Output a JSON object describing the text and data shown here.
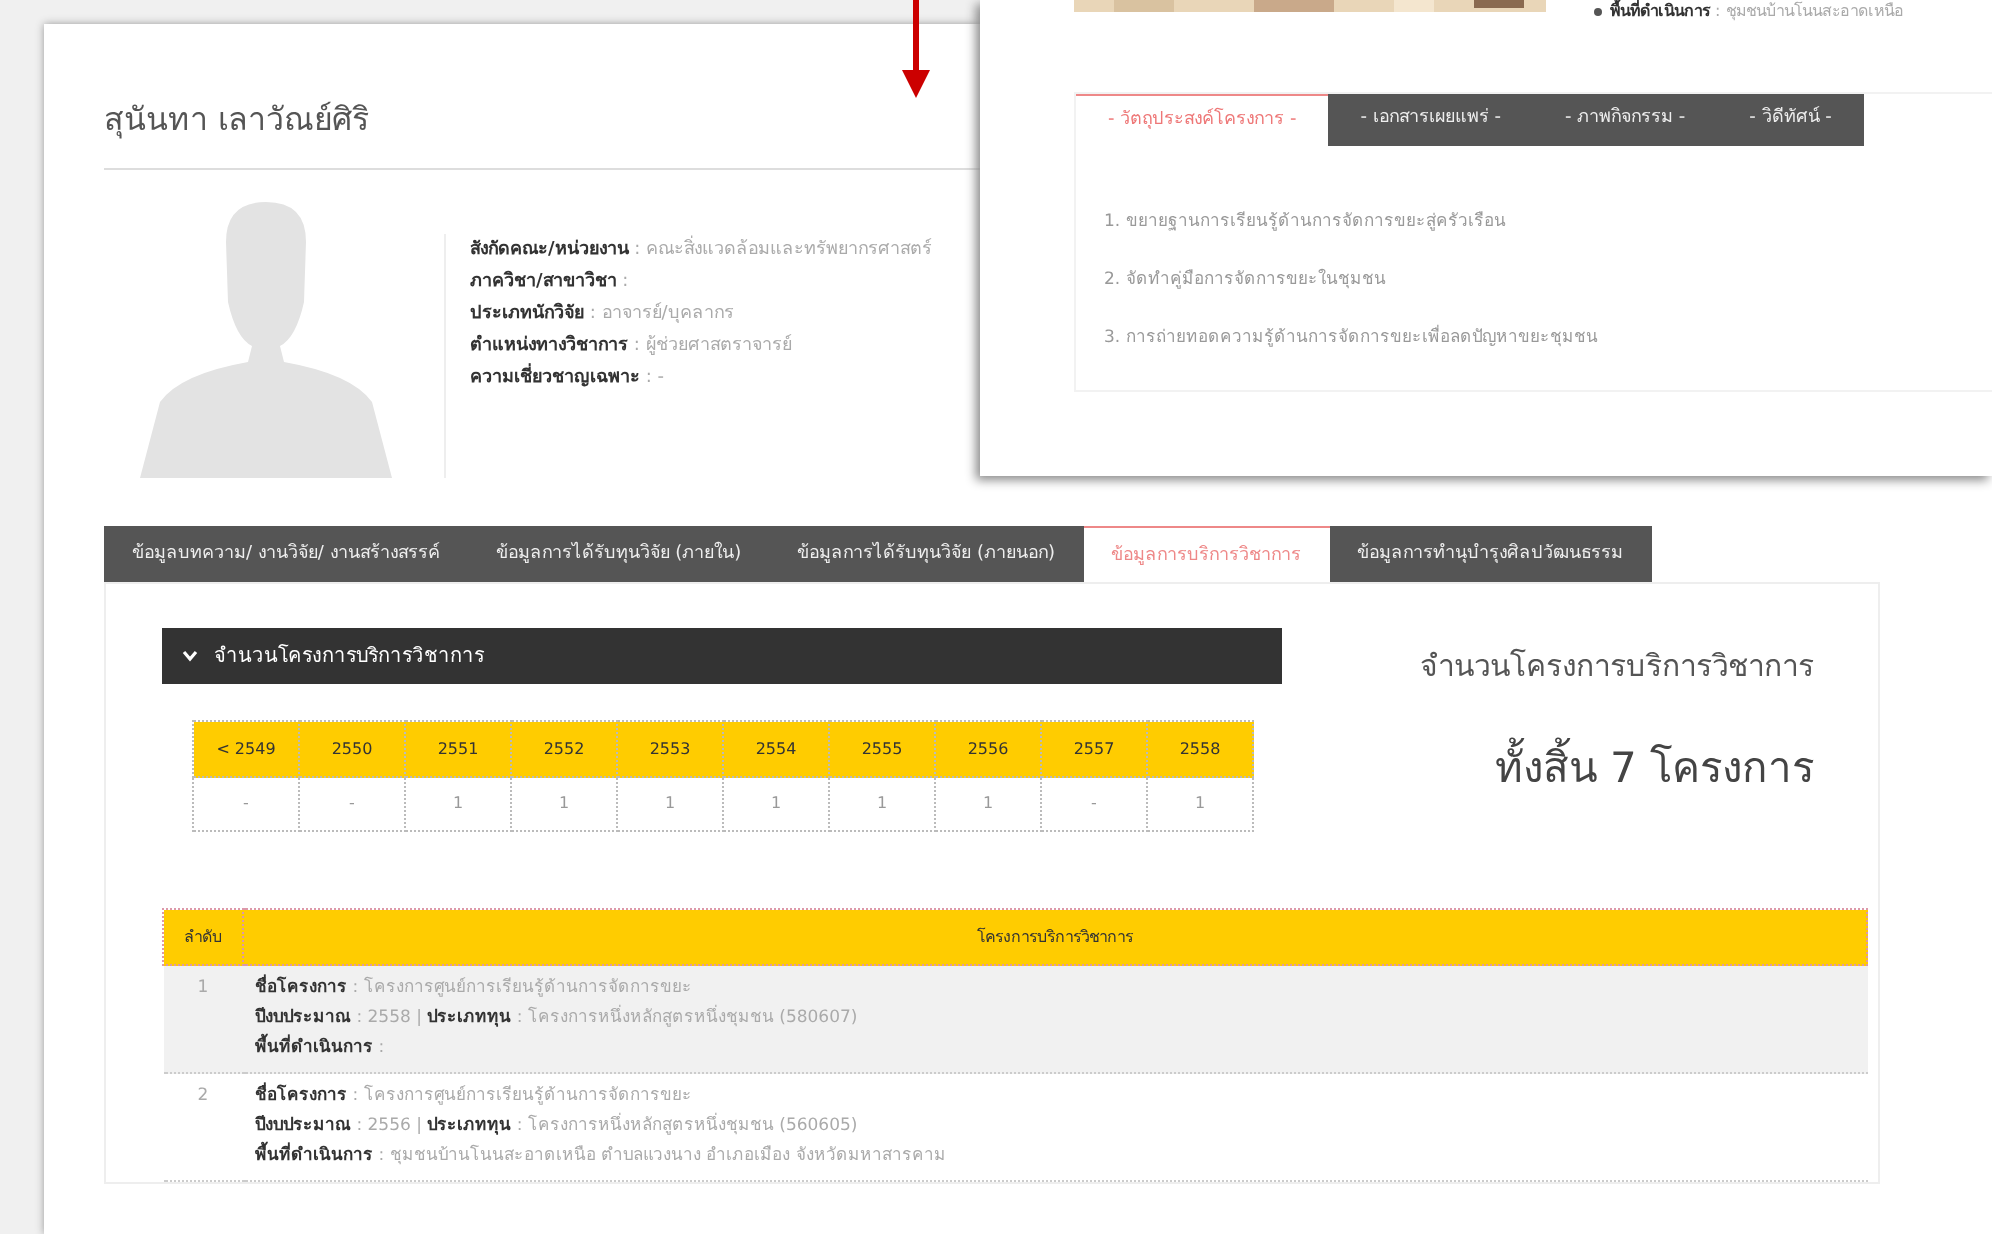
{
  "profile": {
    "name": "สุนันทา เลาวัณย์ศิริ",
    "fields": [
      {
        "label": "สังกัดคณะ/หน่วยงาน",
        "value": ": คณะสิ่งแวดล้อมและทรัพยากรศาสตร์"
      },
      {
        "label": "ภาควิชา/สาขาวิชา",
        "value": ":"
      },
      {
        "label": "ประเภทนักวิจัย",
        "value": ": อาจารย์/บุคลากร"
      },
      {
        "label": "ตำแหน่งทางวิชาการ",
        "value": ": ผู้ช่วยศาสตราจารย์"
      },
      {
        "label": "ความเชี่ยวชาญเฉพาะ",
        "value": ": -"
      }
    ]
  },
  "tabs": [
    {
      "label": "ข้อมูลบทความ/ งานวิจัย/ งานสร้างสรรค์",
      "selected": false
    },
    {
      "label": "ข้อมูลการได้รับทุนวิจัย (ภายใน)",
      "selected": false
    },
    {
      "label": "ข้อมูลการได้รับทุนวิจัย (ภายนอก)",
      "selected": false
    },
    {
      "label": "ข้อมูลการบริการวิชาการ",
      "selected": true
    },
    {
      "label": "ข้อมูลการทำนุบำรุงศิลปวัฒนธรรม",
      "selected": false
    }
  ],
  "summary_panel": {
    "title": "จำนวนโครงการบริการวิชาการ",
    "years": [
      {
        "year": "< 2549",
        "count": "-"
      },
      {
        "year": "2550",
        "count": "-"
      },
      {
        "year": "2551",
        "count": "1"
      },
      {
        "year": "2552",
        "count": "1"
      },
      {
        "year": "2553",
        "count": "1"
      },
      {
        "year": "2554",
        "count": "1"
      },
      {
        "year": "2555",
        "count": "1"
      },
      {
        "year": "2556",
        "count": "1"
      },
      {
        "year": "2557",
        "count": "-"
      },
      {
        "year": "2558",
        "count": "1"
      }
    ],
    "caption": "จำนวนโครงการบริการวิชาการ",
    "total": "ทั้งสิ้น 7 โครงการ"
  },
  "projects_table": {
    "columns": [
      "ลำดับ",
      "โครงการบริการวิชาการ"
    ],
    "rows": [
      {
        "index": "1",
        "lines": [
          [
            {
              "label": "ชื่อโครงการ",
              "value": ": โครงการศูนย์การเรียนรู้ด้านการจัดการขยะ"
            }
          ],
          [
            {
              "label": "ปีงบประมาณ",
              "value": ": 2558 |"
            },
            {
              "label": "ประเภททุน",
              "value": ": โครงการหนึ่งหลักสูตรหนึ่งชุมชน (580607)"
            }
          ],
          [
            {
              "label": "พื้นที่ดำเนินการ",
              "value": ":"
            }
          ]
        ]
      },
      {
        "index": "2",
        "lines": [
          [
            {
              "label": "ชื่อโครงการ",
              "value": ": โครงการศูนย์การเรียนรู้ด้านการจัดการขยะ"
            }
          ],
          [
            {
              "label": "ปีงบประมาณ",
              "value": ": 2556 |"
            },
            {
              "label": "ประเภททุน",
              "value": ": โครงการหนึ่งหลักสูตรหนึ่งชุมชน (560605)"
            }
          ],
          [
            {
              "label": "พื้นที่ดำเนินการ",
              "value": ": ชุมชนบ้านโนนสะอาดเหนือ ตำบลแวงนาง อำเภอเมือง จังหวัดมหาสารคาม"
            }
          ]
        ]
      }
    ]
  },
  "overlay_window": {
    "location": {
      "label": "พื้นที่ดำเนินการ",
      "value": ": ชุมชนบ้านโนนสะอาดเหนือ"
    },
    "tabs": [
      {
        "label": "- วัตถุประสงค์โครงการ -",
        "selected": true
      },
      {
        "label": "- เอกสารเผยแพร่ -",
        "selected": false
      },
      {
        "label": "- ภาพกิจกรรม -",
        "selected": false
      },
      {
        "label": "- วิดีทัศน์ -",
        "selected": false
      }
    ],
    "objectives": [
      "1. ขยายฐานการเรียนรู้ด้านการจัดการขยะสู่ครัวเรือน",
      "2. จัดทำคู่มือการจัดการขยะในชุมชน",
      "3. การถ่ายทอดความรู้ด้านการจัดการขยะเพื่อลดปัญหาขยะชุมชน"
    ]
  }
}
